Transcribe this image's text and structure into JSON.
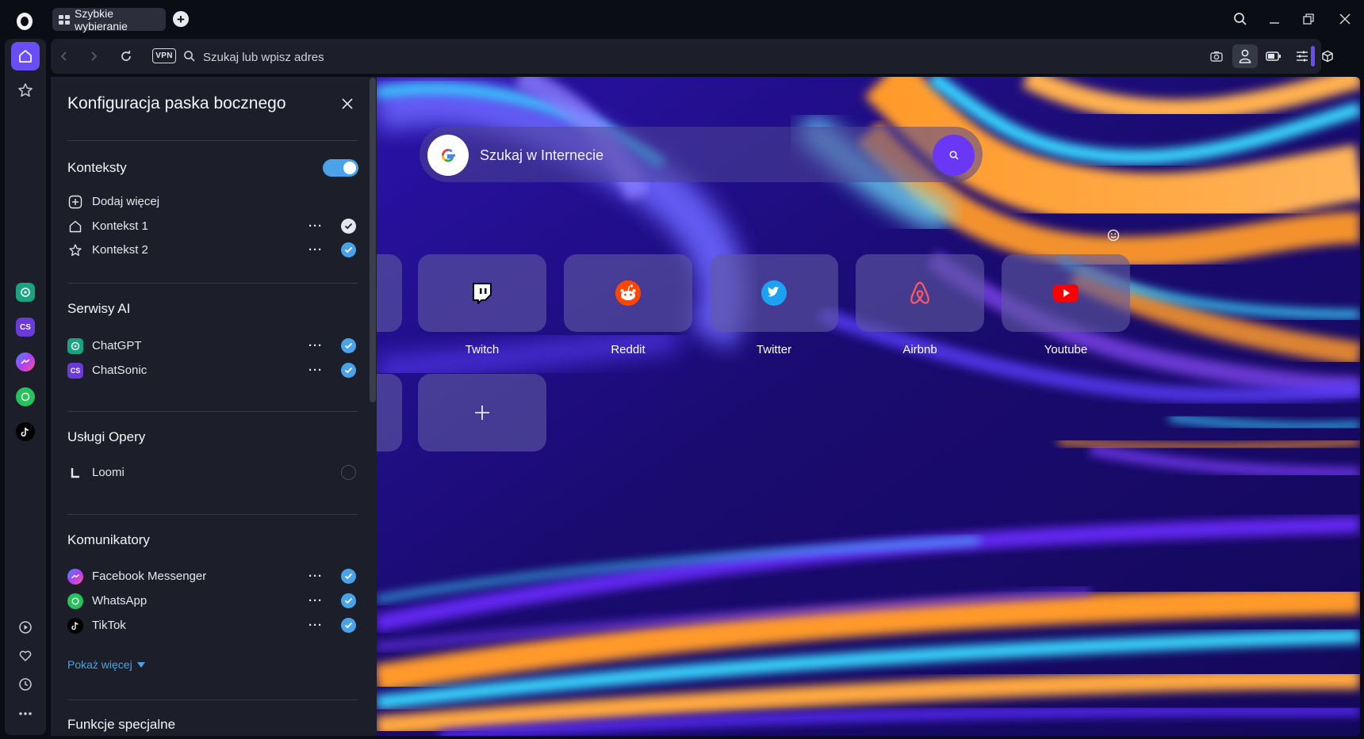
{
  "tab": {
    "title": "Szybkie wybieranie"
  },
  "address_bar": {
    "vpn_label": "VPN",
    "placeholder": "Szukaj lub wpisz adres"
  },
  "search": {
    "placeholder": "Szukaj w Internecie",
    "engine_icon": "google-icon"
  },
  "speed_dial": [
    {
      "label": "Twitch",
      "icon": "twitch-icon"
    },
    {
      "label": "Reddit",
      "icon": "reddit-icon"
    },
    {
      "label": "Twitter",
      "icon": "twitter-icon"
    },
    {
      "label": "Airbnb",
      "icon": "airbnb-icon"
    },
    {
      "label": "Youtube",
      "icon": "youtube-icon"
    }
  ],
  "add_tile": {
    "symbol": "+"
  },
  "panel": {
    "title": "Konfiguracja paska bocznego",
    "sections": {
      "contexts": {
        "title": "Konteksty",
        "toggle_on": true,
        "add_more": "Dodaj więcej",
        "items": [
          {
            "label": "Kontekst 1",
            "checked": true,
            "check_style": "dark"
          },
          {
            "label": "Kontekst 2",
            "checked": true
          }
        ]
      },
      "ai": {
        "title": "Serwisy AI",
        "items": [
          {
            "label": "ChatGPT",
            "checked": true
          },
          {
            "label": "ChatSonic",
            "checked": true,
            "badge": "CS"
          }
        ]
      },
      "opera_services": {
        "title": "Usługi Opery",
        "items": [
          {
            "label": "Loomi",
            "checked": false
          }
        ]
      },
      "messengers": {
        "title": "Komunikatory",
        "items": [
          {
            "label": "Facebook Messenger",
            "checked": true
          },
          {
            "label": "WhatsApp",
            "checked": true
          },
          {
            "label": "TikTok",
            "checked": true
          }
        ],
        "show_more": "Pokaż więcej"
      },
      "special": {
        "title": "Funkcje specjalne"
      }
    }
  },
  "rail": {
    "chatsonic_badge": "CS"
  },
  "colors": {
    "accent": "#6a4df5",
    "check": "#4aa3e8",
    "panel_bg": "#1c1f29",
    "window_bg": "#0b0d14"
  }
}
